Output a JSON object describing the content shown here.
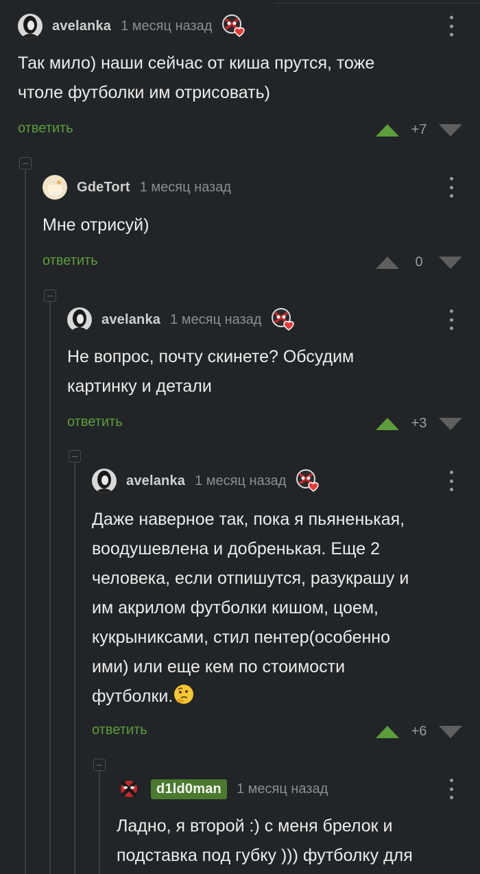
{
  "ui": {
    "reply_label": "ответить"
  },
  "comments": [
    {
      "author": "avelanka",
      "time": "1 месяц назад",
      "award": "deadpool-heart-award",
      "lines": [
        "Так мило) наши сейчас от киша прутся, тоже",
        "чтоле футболки им отрисовать)"
      ],
      "score": "+7",
      "vote": "up"
    },
    {
      "author": "GdeTort",
      "time": "1 месяц назад",
      "lines": [
        "Мне отрисуй)"
      ],
      "score": "0",
      "vote": "none"
    },
    {
      "author": "avelanka",
      "time": "1 месяц назад",
      "award": "deadpool-heart-award",
      "lines": [
        "Не вопрос, почту скинете? Обсудим",
        "картинку и детали"
      ],
      "score": "+3",
      "vote": "up"
    },
    {
      "author": "avelanka",
      "time": "1 месяц назад",
      "award": "deadpool-heart-award",
      "lines": [
        "Даже наверное так, пока я пьяненькая,",
        "воодушевлена и добренькая. Еще 2",
        "человека, если отпишутся, разукрашу и",
        "им акрилом футболки кишом, цоем,",
        "кукрыниксами, стил пентер(особенно",
        "ими) или еще кем по стоимости",
        "футболки."
      ],
      "emoji": "thinking-face-emoji",
      "score": "+6",
      "vote": "up"
    },
    {
      "author": "d1ld0man",
      "time": "1 месяц назад",
      "lines": [
        "Ладно, я второй :) с меня брелок и",
        "подставка под губку ))) футболку для"
      ]
    }
  ]
}
